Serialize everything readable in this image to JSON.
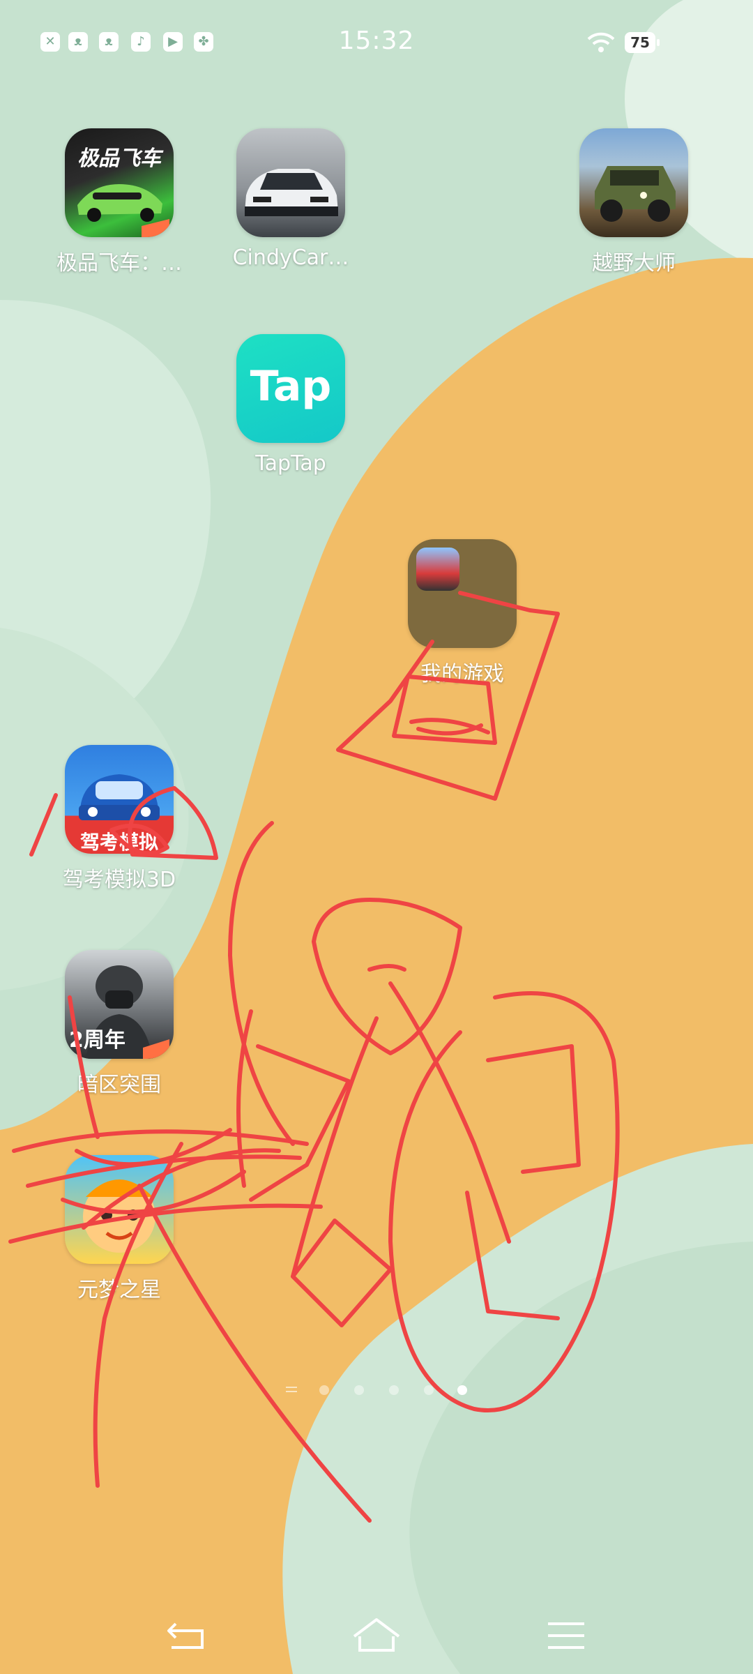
{
  "status_bar": {
    "time": "15:32",
    "battery": "75",
    "notification_icons": [
      "x-app-icon",
      "cat-app-icon",
      "cat-app-icon",
      "tiktok-icon",
      "video-play-icon",
      "clover-icon"
    ]
  },
  "apps": [
    {
      "label": "极品飞车：…",
      "icon": "need-for-speed-icon",
      "badge_text": "极品飞车"
    },
    {
      "label": "CindyCar…",
      "icon": "cindycar-icon"
    },
    {
      "label": "越野大师",
      "icon": "offroad-master-icon"
    },
    {
      "label": "TapTap",
      "icon": "taptap-icon",
      "icon_text": "Tap"
    },
    {
      "label": "我的游戏",
      "icon": "my-games-folder-icon"
    },
    {
      "label": "驾考模拟3D",
      "icon": "driving-test-icon",
      "icon_text": "驾考模拟"
    },
    {
      "label": "暗区突围",
      "icon": "arena-breakout-icon",
      "icon_text": "2周年"
    },
    {
      "label": "元梦之星",
      "icon": "eggy-party-icon"
    }
  ],
  "pager": {
    "pages": 5,
    "active_index": 4
  },
  "colors": {
    "wallpaper_green": "#c8e3d1",
    "wallpaper_light": "#dcefe2",
    "wallpaper_orange": "#f3bf68",
    "scribble_red": "#ef4444"
  }
}
